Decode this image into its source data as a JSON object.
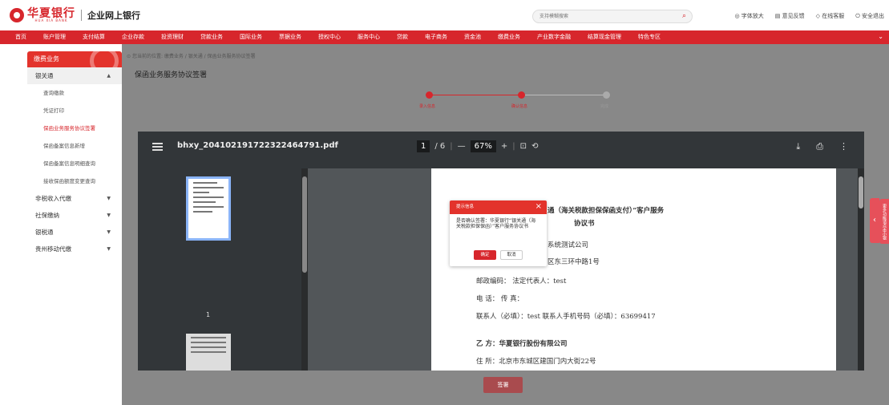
{
  "header": {
    "logo_cn": "华夏银行",
    "logo_en": "HUA XIA BANK",
    "subtitle": "企业网上银行",
    "search_placeholder": "支持模糊搜索",
    "tools": [
      "字体放大",
      "意见反馈",
      "在线客服",
      "安全退出"
    ]
  },
  "nav": {
    "items": [
      "首页",
      "账户管理",
      "支付结算",
      "企业存款",
      "投资理财",
      "贷款业务",
      "国际业务",
      "票据业务",
      "授权中心",
      "服务中心",
      "贷款",
      "电子商务",
      "资金池",
      "缴费业务",
      "产业数字金融",
      "结算现金管理",
      "特色专区"
    ]
  },
  "sidebar": {
    "title": "缴费业务",
    "groups": [
      {
        "label": "银关通",
        "open": true,
        "items": [
          "查询缴款",
          "凭证打印",
          "保函业务服务协议签署",
          "保函备案信息新增",
          "保函备案信息明细查询",
          "接收保函额度变更查询"
        ]
      },
      {
        "label": "非税收入代缴",
        "open": false,
        "items": []
      },
      {
        "label": "社保缴纳",
        "open": false,
        "items": []
      },
      {
        "label": "银税通",
        "open": false,
        "items": []
      },
      {
        "label": "贵州移动代缴",
        "open": false,
        "items": []
      }
    ],
    "active_item": "保函业务服务协议签署"
  },
  "main": {
    "breadcrumb": "您当前的位置: 缴费业务 / 银关通 / 保函业务服务协议签署",
    "title": "保函业务服务协议签署",
    "steps": [
      {
        "label": "录入信息",
        "done": true
      },
      {
        "label": "确认信息",
        "done": true
      },
      {
        "label": "完成",
        "done": false
      }
    ],
    "sign_button": "签署"
  },
  "pdf": {
    "filename": "bhxy_204102191722322464791.pdf",
    "page_current": "1",
    "page_sep": "/ 6",
    "zoom": "67%",
    "thumb_page_number": "1",
    "lines": [
      {
        "text": "通（海关税款担保保函支付）”客户服务",
        "bold": true
      },
      {
        "text": "协议书",
        "bold": true
      },
      {
        "text": "系统测试公司",
        "bold": false
      },
      {
        "text": "区东三环中路1号",
        "bold": false
      },
      {
        "text": "邮政编码：              法定代表人：test",
        "bold": false
      },
      {
        "text": "电    话：              传    真：",
        "bold": false
      },
      {
        "text": "联系人（必填）：test 联系人手机号码（必填）：63699417",
        "bold": false
      },
      {
        "text": "乙    方：华夏银行股份有限公司",
        "bold": true
      },
      {
        "text": "住    所：北京市东城区建国门内大街22号",
        "bold": false
      }
    ]
  },
  "dialog": {
    "title": "提示信息",
    "message": "是否确认签署：华夏银行“银关通（海关税款担保保函）”客户服务协议书",
    "ok": "确定",
    "cancel": "取消"
  },
  "right_tab": {
    "label": "更多功能请点击小银"
  }
}
